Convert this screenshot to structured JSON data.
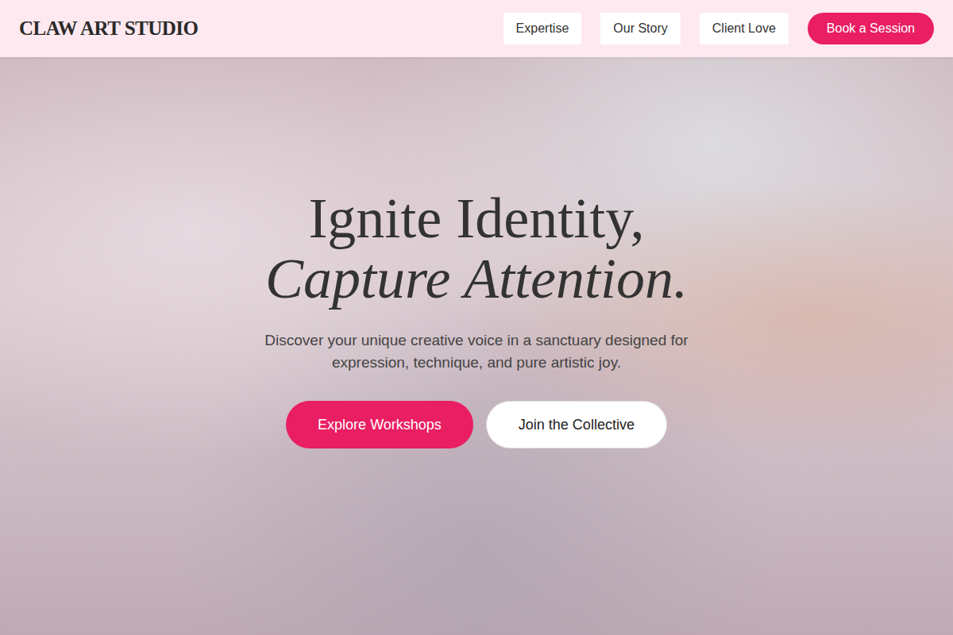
{
  "brand": "CLAW ART STUDIO",
  "nav": {
    "links": [
      {
        "label": "Expertise"
      },
      {
        "label": "Our Story"
      },
      {
        "label": "Client Love"
      }
    ],
    "cta": "Book a Session"
  },
  "hero": {
    "title_line1": "Ignite Identity,",
    "title_line2": "Capture Attention.",
    "subtitle": "Discover your unique creative voice in a sanctuary designed for expression, technique, and pure artistic joy.",
    "buttons": [
      {
        "label": "Explore Workshops",
        "kind": "primary"
      },
      {
        "label": "Join the Collective",
        "kind": "secondary"
      }
    ]
  }
}
